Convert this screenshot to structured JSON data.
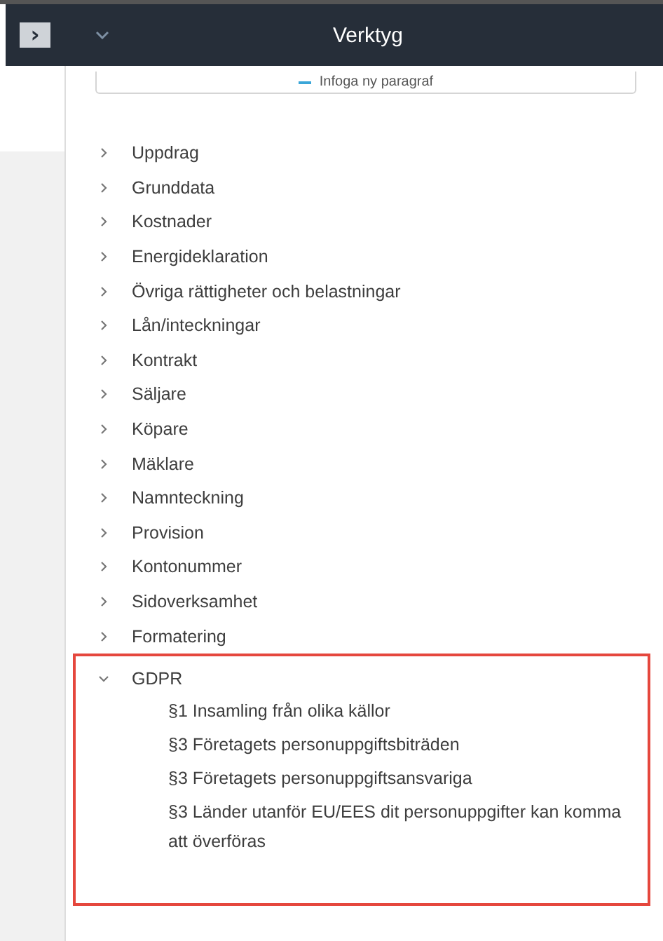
{
  "header": {
    "title": "Verktyg",
    "collapsed_toggle": "›"
  },
  "insert_button": {
    "label": "Infoga ny paragraf"
  },
  "tree": [
    {
      "label": "Uppdrag",
      "expanded": false,
      "highlighted": false
    },
    {
      "label": "Grunddata",
      "expanded": false,
      "highlighted": false
    },
    {
      "label": "Kostnader",
      "expanded": false,
      "highlighted": false
    },
    {
      "label": "Energideklaration",
      "expanded": false,
      "highlighted": false
    },
    {
      "label": "Övriga rättigheter och belastningar",
      "expanded": false,
      "highlighted": false
    },
    {
      "label": "Lån/inteckningar",
      "expanded": false,
      "highlighted": false
    },
    {
      "label": "Kontrakt",
      "expanded": false,
      "highlighted": false
    },
    {
      "label": "Säljare",
      "expanded": false,
      "highlighted": false
    },
    {
      "label": "Köpare",
      "expanded": false,
      "highlighted": false
    },
    {
      "label": "Mäklare",
      "expanded": false,
      "highlighted": false
    },
    {
      "label": "Namnteckning",
      "expanded": false,
      "highlighted": false
    },
    {
      "label": "Provision",
      "expanded": false,
      "highlighted": false
    },
    {
      "label": "Kontonummer",
      "expanded": false,
      "highlighted": false
    },
    {
      "label": "Sidoverksamhet",
      "expanded": false,
      "highlighted": false
    },
    {
      "label": "Formatering",
      "expanded": false,
      "highlighted": false
    },
    {
      "label": "GDPR",
      "expanded": true,
      "highlighted": true,
      "children": [
        {
          "label": "§1 Insamling från olika källor"
        },
        {
          "label": "§3 Företagets personuppgiftsbiträden"
        },
        {
          "label": "§3 Företagets personuppgiftsansvariga"
        },
        {
          "label": "§3 Länder utanför EU/EES dit personuppgifter kan komma att överföras"
        }
      ]
    }
  ]
}
